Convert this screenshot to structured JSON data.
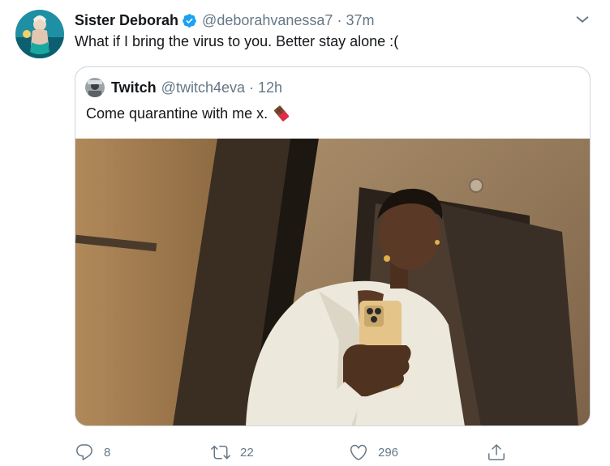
{
  "tweet": {
    "author_name": "Sister Deborah",
    "author_handle": "@deborahvanessa7",
    "separator": "·",
    "time": "37m",
    "text": "What if I bring the virus to you. Better stay alone :("
  },
  "quoted_tweet": {
    "author_name": "Twitch",
    "author_handle": "@twitch4eva",
    "separator": "·",
    "time": "12h",
    "text": "Come quarantine with me x.",
    "emoji_icon": "chocolate-bar-icon"
  },
  "actions": {
    "reply_count": "8",
    "retweet_count": "22",
    "like_count": "296"
  },
  "icons": [
    "verified-badge-icon",
    "chevron-down-icon",
    "reply-icon",
    "retweet-icon",
    "like-icon",
    "share-icon"
  ],
  "colors": {
    "verified_blue": "#1da1f2",
    "secondary_text": "#657786",
    "border": "#ccd6dd"
  }
}
